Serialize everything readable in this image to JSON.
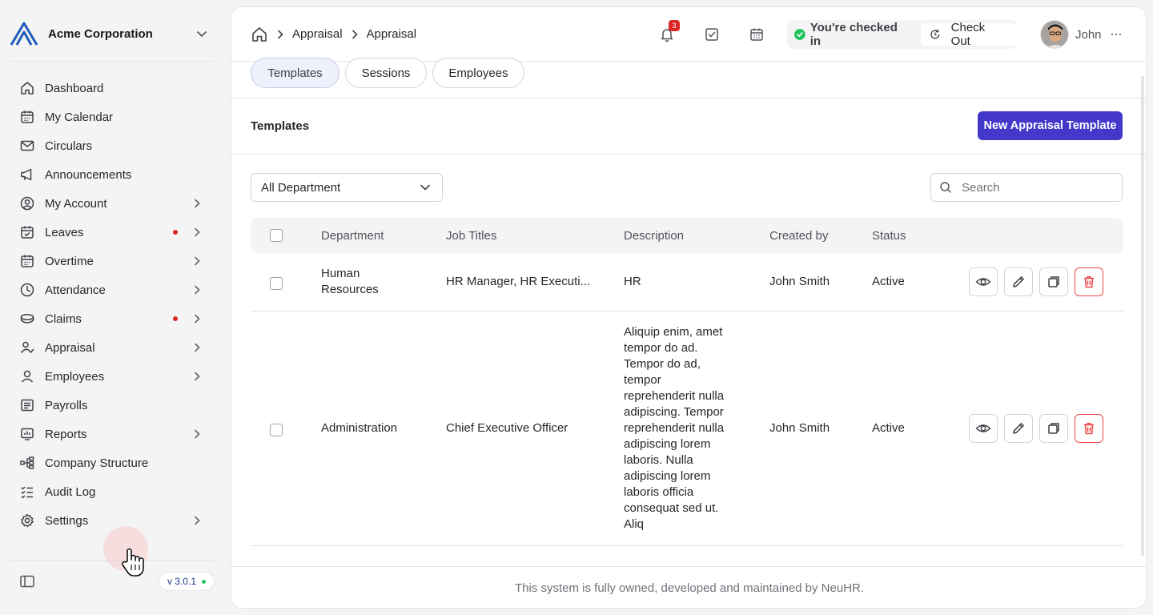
{
  "org": {
    "name": "Acme Corporation"
  },
  "sidebar": {
    "items": [
      {
        "label": "Dashboard",
        "icon": "home-icon",
        "chevron": false,
        "dot": false
      },
      {
        "label": "My Calendar",
        "icon": "calendar-icon",
        "chevron": false,
        "dot": false
      },
      {
        "label": "Circulars",
        "icon": "mail-icon",
        "chevron": false,
        "dot": false
      },
      {
        "label": "Announcements",
        "icon": "megaphone-icon",
        "chevron": false,
        "dot": false
      },
      {
        "label": "My Account",
        "icon": "user-circle-icon",
        "chevron": true,
        "dot": false
      },
      {
        "label": "Leaves",
        "icon": "calendar-check-icon",
        "chevron": true,
        "dot": true
      },
      {
        "label": "Overtime",
        "icon": "calendar-clock-icon",
        "chevron": true,
        "dot": false
      },
      {
        "label": "Attendance",
        "icon": "clock-icon",
        "chevron": true,
        "dot": false
      },
      {
        "label": "Claims",
        "icon": "coins-icon",
        "chevron": true,
        "dot": true
      },
      {
        "label": "Appraisal",
        "icon": "user-check-icon",
        "chevron": true,
        "dot": false
      },
      {
        "label": "Employees",
        "icon": "user-icon",
        "chevron": true,
        "dot": false
      },
      {
        "label": "Payrolls",
        "icon": "receipt-icon",
        "chevron": false,
        "dot": false
      },
      {
        "label": "Reports",
        "icon": "chart-board-icon",
        "chevron": true,
        "dot": false
      },
      {
        "label": "Company Structure",
        "icon": "hierarchy-icon",
        "chevron": false,
        "dot": false
      },
      {
        "label": "Audit Log",
        "icon": "checklist-icon",
        "chevron": false,
        "dot": false
      },
      {
        "label": "Settings",
        "icon": "gear-icon",
        "chevron": true,
        "dot": false
      }
    ],
    "version": "v 3.0.1"
  },
  "breadcrumb": [
    "Appraisal",
    "Appraisal"
  ],
  "header": {
    "notification_count": "3",
    "checkin_status": "You're checked in",
    "checkout_label": "Check Out",
    "user_name": "John"
  },
  "tabs": [
    {
      "label": "Templates",
      "active": true
    },
    {
      "label": "Sessions",
      "active": false
    },
    {
      "label": "Employees",
      "active": false
    }
  ],
  "section": {
    "title": "Templates",
    "new_button": "New Appraisal Template"
  },
  "filters": {
    "department": "All Department",
    "search_placeholder": "Search"
  },
  "table": {
    "columns": [
      "Department",
      "Job Titles",
      "Description",
      "Created by",
      "Status"
    ],
    "rows": [
      {
        "department": "Human Resources",
        "job_titles": "HR Manager, HR Executi...",
        "description": "HR",
        "created_by": "John Smith",
        "status": "Active"
      },
      {
        "department": "Administration",
        "job_titles": "Chief Executive Officer",
        "description": "Aliquip enim, amet tempor do ad. Tempor do ad, tempor reprehenderit nulla adipiscing. Tempor reprehenderit nulla adipiscing lorem laboris. Nulla adipiscing lorem laboris officia consequat sed ut. Aliq",
        "created_by": "John Smith",
        "status": "Active"
      }
    ]
  },
  "footer": "This system is fully owned, developed and maintained by NeuHR.",
  "colors": {
    "accent": "#4338ca",
    "danger": "#ef4444",
    "success": "#22c55e"
  }
}
